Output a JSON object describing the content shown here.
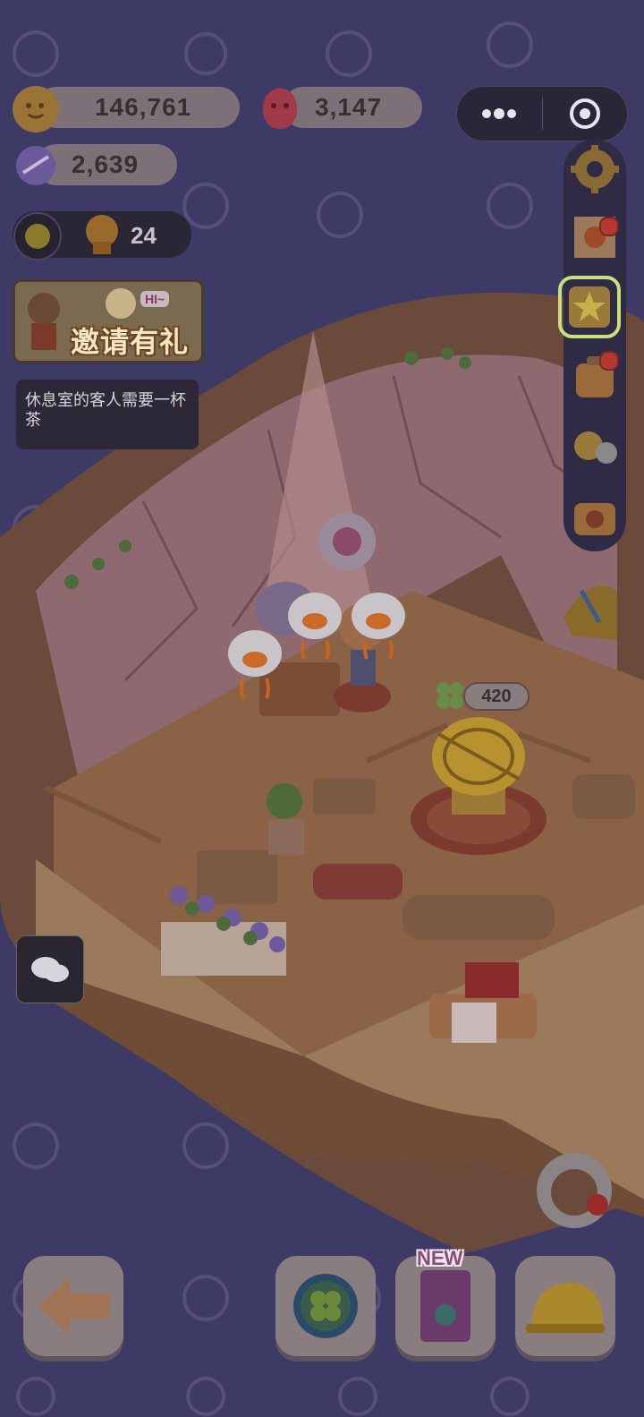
{
  "resources": {
    "coins": "146,761",
    "gems": "3,147",
    "candy": "2,639",
    "sun_count": "24"
  },
  "capsule": {
    "more_icon": "more-dots-icon",
    "close_icon": "target-circle-icon"
  },
  "invite_banner": {
    "label": "邀请有礼",
    "badge": "HI~"
  },
  "quest": {
    "text": "休息室的客人需要一杯茶"
  },
  "furniture_price": "420",
  "bottom_bar": {
    "new_badge": "NEW"
  },
  "colors": {
    "overlay": "#3e3a66",
    "pill": "#7d7078",
    "notification": "#b5392e",
    "highlight_frame": "#c8e07a"
  }
}
